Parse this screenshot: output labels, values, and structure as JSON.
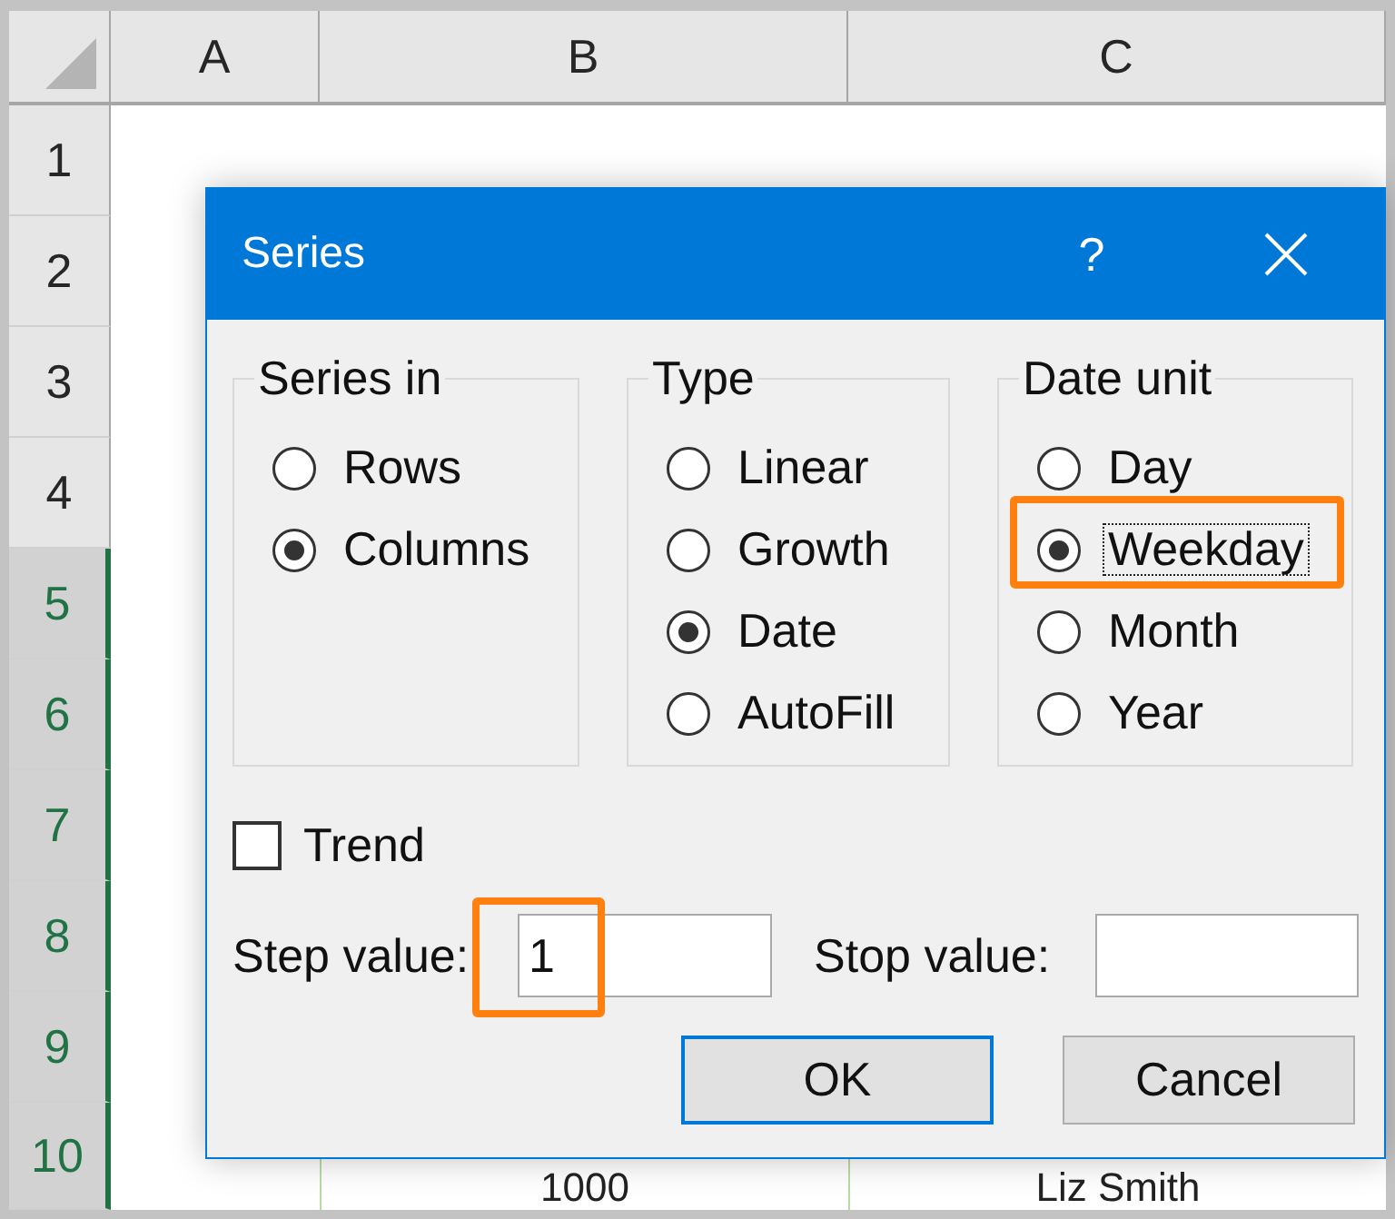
{
  "spreadsheet": {
    "columns": [
      "A",
      "B",
      "C"
    ],
    "rows": [
      {
        "number": "1",
        "selected": false
      },
      {
        "number": "2",
        "selected": false
      },
      {
        "number": "3",
        "selected": false
      },
      {
        "number": "4",
        "selected": false
      },
      {
        "number": "5",
        "selected": true
      },
      {
        "number": "6",
        "selected": true
      },
      {
        "number": "7",
        "selected": true
      },
      {
        "number": "8",
        "selected": true
      },
      {
        "number": "9",
        "selected": true
      },
      {
        "number": "10",
        "selected": true,
        "cells": [
          null,
          "1000",
          "Liz Smith"
        ]
      }
    ]
  },
  "dialog": {
    "title": "Series",
    "help_button": "?",
    "groups": [
      {
        "label": "Series in",
        "options": [
          {
            "label": "Rows",
            "selected": false,
            "focused": false,
            "highlighted": false
          },
          {
            "label": "Columns",
            "selected": true,
            "focused": false,
            "highlighted": false
          }
        ]
      },
      {
        "label": "Type",
        "options": [
          {
            "label": "Linear",
            "selected": false,
            "focused": false,
            "highlighted": false
          },
          {
            "label": "Growth",
            "selected": false,
            "focused": false,
            "highlighted": false
          },
          {
            "label": "Date",
            "selected": true,
            "focused": false,
            "highlighted": false
          },
          {
            "label": "AutoFill",
            "selected": false,
            "focused": false,
            "highlighted": false
          }
        ]
      },
      {
        "label": "Date unit",
        "options": [
          {
            "label": "Day",
            "selected": false,
            "focused": false,
            "highlighted": false
          },
          {
            "label": "Weekday",
            "selected": true,
            "focused": true,
            "highlighted": true
          },
          {
            "label": "Month",
            "selected": false,
            "focused": false,
            "highlighted": false
          },
          {
            "label": "Year",
            "selected": false,
            "focused": false,
            "highlighted": false
          }
        ]
      }
    ],
    "trend": {
      "label": "Trend",
      "checked": false
    },
    "step_value": {
      "label": "Step value:",
      "value": "1",
      "highlighted": true
    },
    "stop_value": {
      "label": "Stop value:",
      "highlighted": false
    },
    "buttons": [
      {
        "label": "OK",
        "default": true
      },
      {
        "label": "Cancel",
        "default": false
      }
    ]
  }
}
